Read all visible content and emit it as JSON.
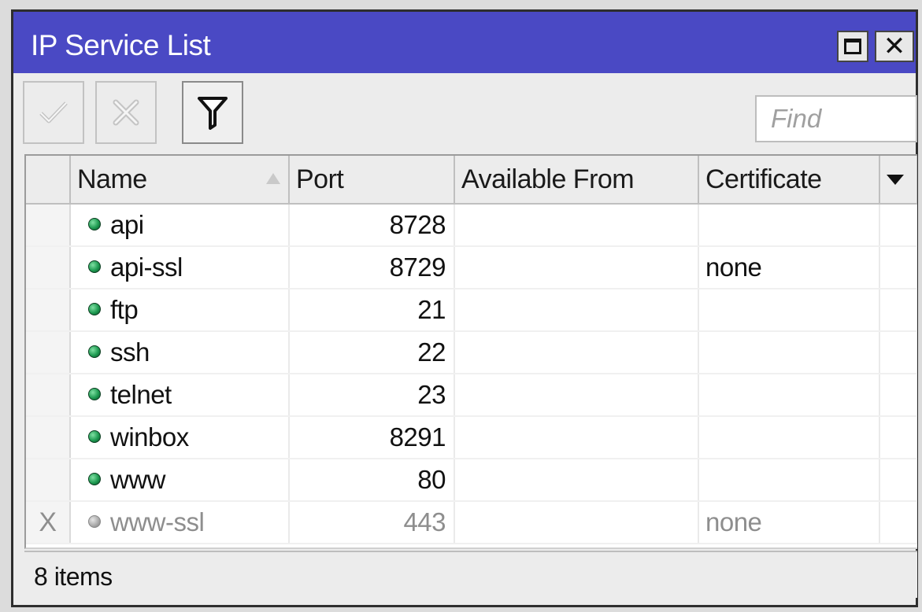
{
  "window": {
    "title": "IP Service List"
  },
  "toolbar": {
    "enable_icon": "check-icon",
    "disable_icon": "cross-icon",
    "filter_icon": "funnel-icon",
    "find_placeholder": "Find"
  },
  "table": {
    "columns": [
      "",
      "Name",
      "Port",
      "Available From",
      "Certificate"
    ],
    "rows": [
      {
        "flag": "",
        "name": "api",
        "port": "8728",
        "available_from": "",
        "certificate": "",
        "enabled": true
      },
      {
        "flag": "",
        "name": "api-ssl",
        "port": "8729",
        "available_from": "",
        "certificate": "none",
        "enabled": true
      },
      {
        "flag": "",
        "name": "ftp",
        "port": "21",
        "available_from": "",
        "certificate": "",
        "enabled": true
      },
      {
        "flag": "",
        "name": "ssh",
        "port": "22",
        "available_from": "",
        "certificate": "",
        "enabled": true
      },
      {
        "flag": "",
        "name": "telnet",
        "port": "23",
        "available_from": "",
        "certificate": "",
        "enabled": true
      },
      {
        "flag": "",
        "name": "winbox",
        "port": "8291",
        "available_from": "",
        "certificate": "",
        "enabled": true
      },
      {
        "flag": "",
        "name": "www",
        "port": "80",
        "available_from": "",
        "certificate": "",
        "enabled": true
      },
      {
        "flag": "X",
        "name": "www-ssl",
        "port": "443",
        "available_from": "",
        "certificate": "none",
        "enabled": false
      }
    ]
  },
  "status": {
    "count_text": "8 items"
  },
  "colors": {
    "titlebar": "#4a49c4",
    "enabled_dot": "#1e9a51",
    "disabled_text": "#8e8e8e"
  }
}
